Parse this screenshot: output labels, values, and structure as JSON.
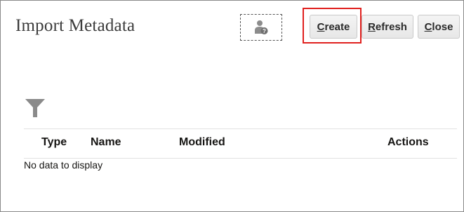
{
  "page": {
    "title": "Import Metadata"
  },
  "toolbar": {
    "help_icon": "user-help-icon",
    "create": {
      "first": "C",
      "rest": "reate"
    },
    "refresh": {
      "first": "R",
      "rest": "efresh"
    },
    "close": {
      "first": "C",
      "rest": "lose"
    },
    "highlight_color": "#e0201e"
  },
  "filter": {
    "icon": "filter-icon"
  },
  "table": {
    "columns": [
      "Type",
      "Name",
      "Modified",
      "Actions"
    ],
    "empty_message": "No data to display"
  }
}
